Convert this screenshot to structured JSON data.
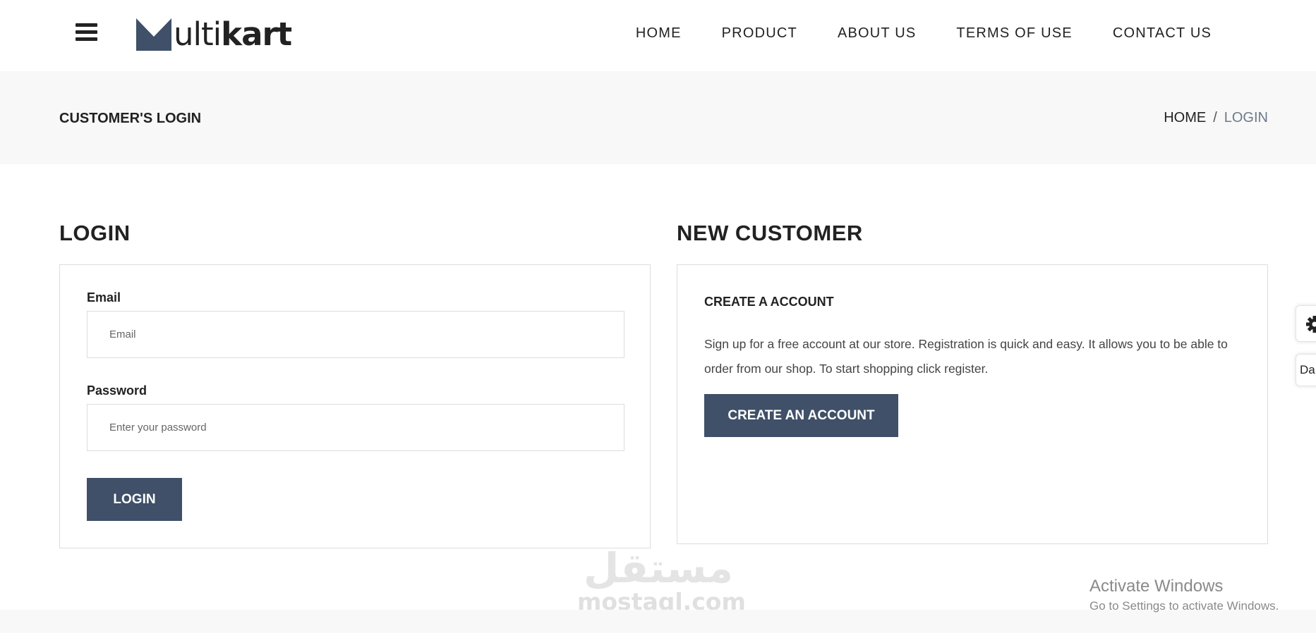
{
  "header": {
    "logo_text_light": "ulti",
    "logo_text_bold": "kart",
    "nav": [
      "HOME",
      "PRODUCT",
      "ABOUT US",
      "TERMS OF USE",
      "CONTACT US"
    ]
  },
  "breadcrumb_bar": {
    "title": "CUSTOMER'S LOGIN",
    "home": "HOME",
    "separator": "/",
    "current": "LOGIN"
  },
  "login": {
    "heading": "LOGIN",
    "email_label": "Email",
    "email_placeholder": "Email",
    "email_value": "",
    "password_label": "Password",
    "password_placeholder": "Enter your password",
    "password_value": "",
    "button_label": "LOGIN"
  },
  "new_customer": {
    "heading": "NEW CUSTOMER",
    "subheading": "CREATE A ACCOUNT",
    "description": "Sign up for a free account at our store. Registration is quick and easy. It allows you to be able to order from our shop. To start shopping click register.",
    "button_label": "CREATE AN ACCOUNT"
  },
  "side_tabs": {
    "gear_icon": "gear-icon",
    "dark_label": "Da"
  },
  "watermarks": {
    "mostaql_arabic": "مستقل",
    "mostaql_latin": "mostaql.com",
    "activate_title": "Activate Windows",
    "activate_sub": "Go to Settings to activate Windows."
  },
  "colors": {
    "accent": "#3f5068",
    "band": "#f8f8f8",
    "text": "#222222",
    "border": "#dddddd"
  }
}
